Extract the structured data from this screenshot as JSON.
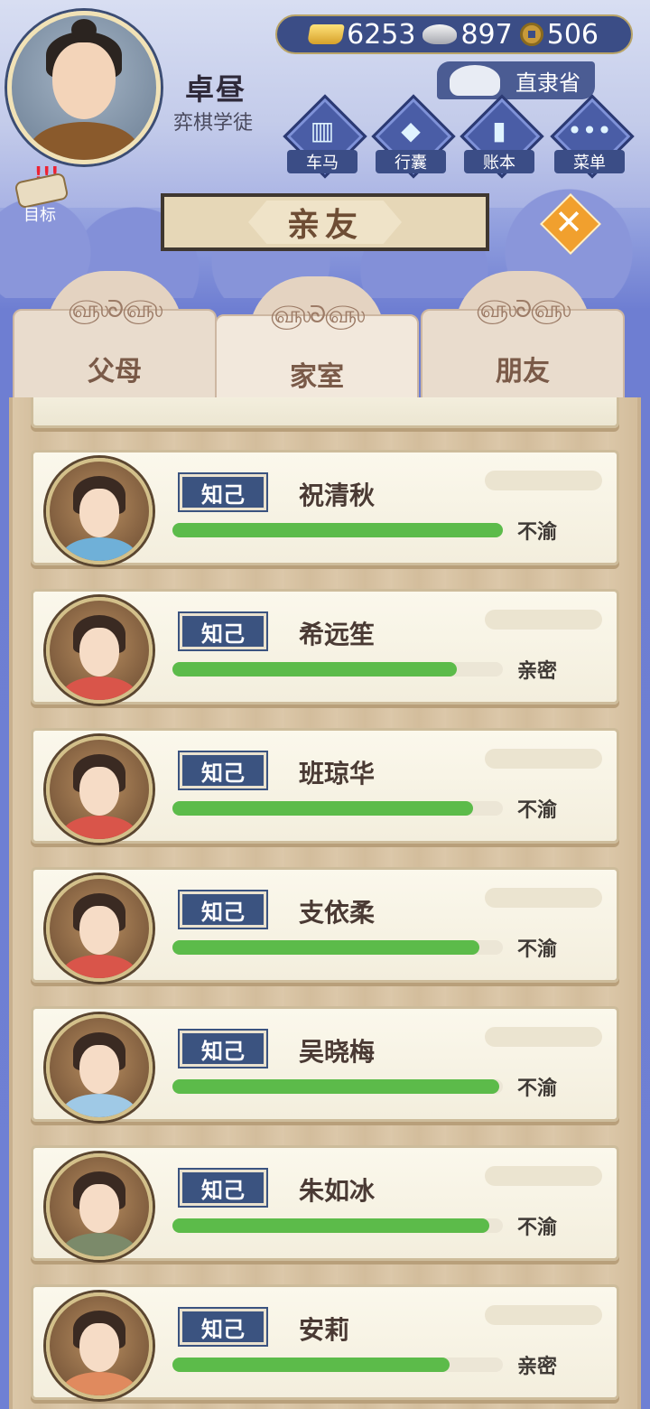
{
  "player": {
    "name": "卓昼",
    "title": "弈棋学徒",
    "region": "直隶省"
  },
  "currencies": {
    "gold": "6253",
    "silver": "897",
    "coins": "506"
  },
  "menu": [
    {
      "label": "车马",
      "icon": "carriage-icon"
    },
    {
      "label": "行囊",
      "icon": "bag-icon"
    },
    {
      "label": "账本",
      "icon": "ledger-icon"
    },
    {
      "label": "菜单",
      "icon": "more-icon"
    }
  ],
  "goal_label": "目标",
  "page_title": "亲友",
  "tabs": [
    {
      "label": "父母",
      "active": false
    },
    {
      "label": "家室",
      "active": true
    },
    {
      "label": "朋友",
      "active": false
    }
  ],
  "relations": [
    {
      "badge": "知己",
      "name": "祝清秋",
      "status": "不渝",
      "level": 1.0,
      "robe": "#6fb0d8"
    },
    {
      "badge": "知己",
      "name": "希远笙",
      "status": "亲密",
      "level": 0.86,
      "robe": "#d9554a"
    },
    {
      "badge": "知己",
      "name": "班琼华",
      "status": "不渝",
      "level": 0.91,
      "robe": "#d9554a"
    },
    {
      "badge": "知己",
      "name": "支依柔",
      "status": "不渝",
      "level": 0.93,
      "robe": "#d9554a"
    },
    {
      "badge": "知己",
      "name": "吴晓梅",
      "status": "不渝",
      "level": 0.99,
      "robe": "#9fc9e6"
    },
    {
      "badge": "知己",
      "name": "朱如冰",
      "status": "不渝",
      "level": 0.96,
      "robe": "#7b8a6a"
    },
    {
      "badge": "知己",
      "name": "安莉",
      "status": "亲密",
      "level": 0.84,
      "robe": "#e08a5e"
    }
  ]
}
